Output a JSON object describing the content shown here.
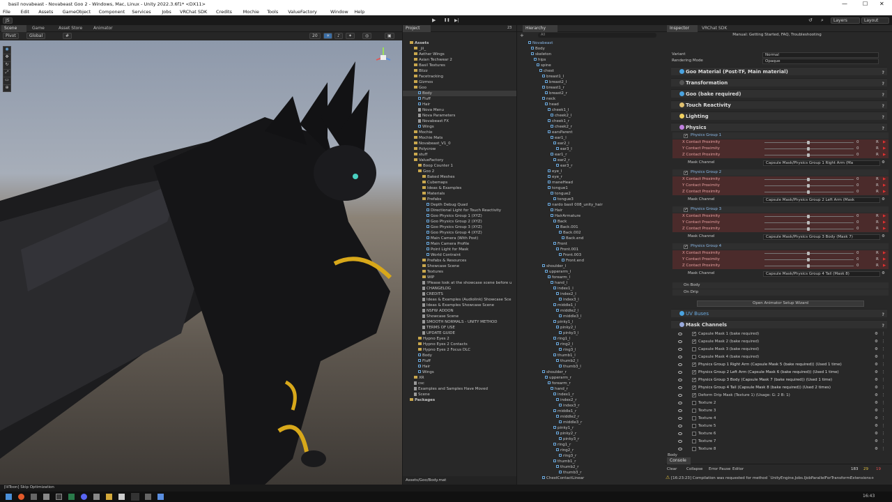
{
  "window": {
    "title": "basil novabeast - Novabeast Goo 2 - Windows, Mac, Linux - Unity 2022.3.6f1* <DX11>",
    "minimize": "—",
    "maximize": "☐",
    "close": "✕"
  },
  "menu": [
    "File",
    "Edit",
    "Assets",
    "GameObject",
    "Component",
    "Services",
    "Jobs",
    "VRChat SDK",
    "Credits",
    "Mochie",
    "Tools",
    "ValueFactory",
    "Window",
    "Help"
  ],
  "toolbar": {
    "account": "JS",
    "play": "▶",
    "pause": "❚❚",
    "step": "▶|",
    "layers": "Layers",
    "layout": "Layout"
  },
  "scene_tabs": [
    "Scene",
    "Game",
    "Asset Store",
    "Animator"
  ],
  "scene_toolbar": {
    "pivot": "Pivot",
    "global": "Global",
    "grid_size": "20"
  },
  "project": {
    "tab": "Project",
    "count": "23",
    "items": [
      {
        "label": "Assets",
        "d": 0,
        "k": "folder",
        "b": true
      },
      {
        "label": "_jii_",
        "d": 1,
        "k": "folder"
      },
      {
        "label": "Aether Wings",
        "d": 1,
        "k": "folder"
      },
      {
        "label": "Asian Techwear 2",
        "d": 1,
        "k": "folder"
      },
      {
        "label": "Basil Textures",
        "d": 1,
        "k": "folder"
      },
      {
        "label": "Blizz",
        "d": 1,
        "k": "folder"
      },
      {
        "label": "Facetracking",
        "d": 1,
        "k": "folder"
      },
      {
        "label": "Gizmos",
        "d": 1,
        "k": "folder"
      },
      {
        "label": "Goo",
        "d": 1,
        "k": "folder"
      },
      {
        "label": "Body",
        "d": 2,
        "k": "obj",
        "sel": true
      },
      {
        "label": "Fluff",
        "d": 2,
        "k": "obj"
      },
      {
        "label": "Hair",
        "d": 2,
        "k": "obj"
      },
      {
        "label": "Nova Menu",
        "d": 2,
        "k": "file"
      },
      {
        "label": "Nova Parameters",
        "d": 2,
        "k": "file"
      },
      {
        "label": "Novabeast FX",
        "d": 2,
        "k": "file"
      },
      {
        "label": "Wings",
        "d": 2,
        "k": "obj"
      },
      {
        "label": "Mochie",
        "d": 1,
        "k": "folder"
      },
      {
        "label": "Mochie Mats",
        "d": 1,
        "k": "folder"
      },
      {
        "label": "Novabeast_V1_0",
        "d": 1,
        "k": "folder"
      },
      {
        "label": "Polycrow",
        "d": 1,
        "k": "folder"
      },
      {
        "label": "stuff",
        "d": 1,
        "k": "folder"
      },
      {
        "label": "ValueFactory",
        "d": 1,
        "k": "folder"
      },
      {
        "label": "Boop Counter 1",
        "d": 2,
        "k": "folder"
      },
      {
        "label": "Goo 2",
        "d": 2,
        "k": "folder"
      },
      {
        "label": "Baked Meshes",
        "d": 3,
        "k": "folder"
      },
      {
        "label": "Cubemaps",
        "d": 3,
        "k": "folder"
      },
      {
        "label": "Ideas & Examples",
        "d": 3,
        "k": "folder"
      },
      {
        "label": "Materials",
        "d": 3,
        "k": "folder"
      },
      {
        "label": "Prefabs",
        "d": 3,
        "k": "folder"
      },
      {
        "label": "Depth Debug Quad",
        "d": 4,
        "k": "obj"
      },
      {
        "label": "Directional Light for Touch Reactivity",
        "d": 4,
        "k": "obj"
      },
      {
        "label": "Goo Physics Group 1 (XYZ)",
        "d": 4,
        "k": "obj"
      },
      {
        "label": "Goo Physics Group 2 (XYZ)",
        "d": 4,
        "k": "obj"
      },
      {
        "label": "Goo Physics Group 3 (XYZ)",
        "d": 4,
        "k": "obj"
      },
      {
        "label": "Goo Physics Group 4 (XYZ)",
        "d": 4,
        "k": "obj"
      },
      {
        "label": "Main Camera (With Post)",
        "d": 4,
        "k": "obj"
      },
      {
        "label": "Main Camera Profile",
        "d": 4,
        "k": "obj"
      },
      {
        "label": "Point Light for Mask",
        "d": 4,
        "k": "obj"
      },
      {
        "label": "World Contraint",
        "d": 4,
        "k": "obj"
      },
      {
        "label": "Prefabs & Resources",
        "d": 3,
        "k": "folder"
      },
      {
        "label": "Showcase Scene",
        "d": 3,
        "k": "folder"
      },
      {
        "label": "Textures",
        "d": 3,
        "k": "folder"
      },
      {
        "label": "WIP",
        "d": 3,
        "k": "folder"
      },
      {
        "label": "!Please look at the showcase scene before u",
        "d": 3,
        "k": "file"
      },
      {
        "label": "CHANGELOG",
        "d": 3,
        "k": "file"
      },
      {
        "label": "CREDITS",
        "d": 3,
        "k": "file"
      },
      {
        "label": "Ideas & Examples (Audiolink) Showcase Sce",
        "d": 3,
        "k": "file"
      },
      {
        "label": "Ideas & Examples Showcase Scene",
        "d": 3,
        "k": "file"
      },
      {
        "label": "NSFW ADDON",
        "d": 3,
        "k": "file"
      },
      {
        "label": "Showcase Scene",
        "d": 3,
        "k": "file"
      },
      {
        "label": "SMOOTH NORMALS - UNITY METHOD",
        "d": 3,
        "k": "file"
      },
      {
        "label": "TERMS OF USE",
        "d": 3,
        "k": "file"
      },
      {
        "label": "UPDATE GUIDE",
        "d": 3,
        "k": "file"
      },
      {
        "label": "Hypno Eyes 2",
        "d": 2,
        "k": "folder"
      },
      {
        "label": "Hypno Eyes 2 Contacts",
        "d": 2,
        "k": "folder"
      },
      {
        "label": "Hypno Eyes 2 Focus DLC",
        "d": 2,
        "k": "folder"
      },
      {
        "label": "Body",
        "d": 2,
        "k": "obj"
      },
      {
        "label": "Fluff",
        "d": 2,
        "k": "obj"
      },
      {
        "label": "Hair",
        "d": 2,
        "k": "obj"
      },
      {
        "label": "Wings",
        "d": 2,
        "k": "obj"
      },
      {
        "label": "XR",
        "d": 1,
        "k": "folder"
      },
      {
        "label": "csc",
        "d": 1,
        "k": "file"
      },
      {
        "label": "Examples and Samples Have Moved",
        "d": 1,
        "k": "file"
      },
      {
        "label": "Scene",
        "d": 1,
        "k": "file"
      },
      {
        "label": "Packages",
        "d": 0,
        "k": "folder",
        "b": true
      }
    ],
    "path": "Assets/Goo/Body.mat"
  },
  "hierarchy": {
    "tab": "Hierarchy",
    "search_placeholder": "All",
    "items": [
      {
        "label": "Novabeast",
        "d": 0
      },
      {
        "label": "Body",
        "d": 1
      },
      {
        "label": "skeleton",
        "d": 1
      },
      {
        "label": "hips",
        "d": 2
      },
      {
        "label": "spine",
        "d": 3
      },
      {
        "label": "chest",
        "d": 4
      },
      {
        "label": "breast1_l",
        "d": 5
      },
      {
        "label": "breast2_l",
        "d": 6
      },
      {
        "label": "breast1_r",
        "d": 5
      },
      {
        "label": "breast2_r",
        "d": 6
      },
      {
        "label": "neck",
        "d": 5
      },
      {
        "label": "head",
        "d": 6
      },
      {
        "label": "cheek1_l",
        "d": 7
      },
      {
        "label": "cheek2_l",
        "d": 8
      },
      {
        "label": "cheek1_r",
        "d": 7
      },
      {
        "label": "cheek2_r",
        "d": 8
      },
      {
        "label": "earsParent",
        "d": 7
      },
      {
        "label": "ear1_l",
        "d": 8
      },
      {
        "label": "ear2_l",
        "d": 9
      },
      {
        "label": "ear3_l",
        "d": 10
      },
      {
        "label": "ear1_r",
        "d": 8
      },
      {
        "label": "ear2_r",
        "d": 9
      },
      {
        "label": "ear3_r",
        "d": 10
      },
      {
        "label": "eye_l",
        "d": 7
      },
      {
        "label": "eye_r",
        "d": 7
      },
      {
        "label": "maneHead",
        "d": 7
      },
      {
        "label": "tongue1",
        "d": 7
      },
      {
        "label": "tongue2",
        "d": 8
      },
      {
        "label": "tongue3",
        "d": 9
      },
      {
        "label": "nardo basil 008_unity_hair",
        "d": 7
      },
      {
        "label": "Hair",
        "d": 8
      },
      {
        "label": "HairArmature",
        "d": 8
      },
      {
        "label": "Back",
        "d": 9
      },
      {
        "label": "Back.001",
        "d": 10
      },
      {
        "label": "Back.002",
        "d": 11
      },
      {
        "label": "Back.end",
        "d": 12
      },
      {
        "label": "Front",
        "d": 9
      },
      {
        "label": "Front.001",
        "d": 10
      },
      {
        "label": "Front.003",
        "d": 11
      },
      {
        "label": "Front.end",
        "d": 12
      },
      {
        "label": "shoulder_l",
        "d": 5
      },
      {
        "label": "upperarm_l",
        "d": 6
      },
      {
        "label": "forearm_l",
        "d": 7
      },
      {
        "label": "hand_l",
        "d": 8
      },
      {
        "label": "index1_l",
        "d": 9
      },
      {
        "label": "index2_l",
        "d": 10
      },
      {
        "label": "index3_l",
        "d": 11
      },
      {
        "label": "middle1_l",
        "d": 9
      },
      {
        "label": "middle2_l",
        "d": 10
      },
      {
        "label": "middle3_l",
        "d": 11
      },
      {
        "label": "pinky1_l",
        "d": 9
      },
      {
        "label": "pinky2_l",
        "d": 10
      },
      {
        "label": "pinky3_l",
        "d": 11
      },
      {
        "label": "ring1_l",
        "d": 9
      },
      {
        "label": "ring2_l",
        "d": 10
      },
      {
        "label": "ring3_l",
        "d": 11
      },
      {
        "label": "thumb1_l",
        "d": 9
      },
      {
        "label": "thumb2_l",
        "d": 10
      },
      {
        "label": "thumb3_l",
        "d": 11
      },
      {
        "label": "shoulder_r",
        "d": 5
      },
      {
        "label": "upperarm_r",
        "d": 6
      },
      {
        "label": "forearm_r",
        "d": 7
      },
      {
        "label": "hand_r",
        "d": 8
      },
      {
        "label": "index1_r",
        "d": 9
      },
      {
        "label": "index2_r",
        "d": 10
      },
      {
        "label": "index3_r",
        "d": 11
      },
      {
        "label": "middle1_r",
        "d": 9
      },
      {
        "label": "middle2_r",
        "d": 10
      },
      {
        "label": "middle3_r",
        "d": 11
      },
      {
        "label": "pinky1_r",
        "d": 9
      },
      {
        "label": "pinky2_r",
        "d": 10
      },
      {
        "label": "pinky3_r",
        "d": 11
      },
      {
        "label": "ring1_r",
        "d": 9
      },
      {
        "label": "ring2_r",
        "d": 10
      },
      {
        "label": "ring3_r",
        "d": 11
      },
      {
        "label": "thumb1_r",
        "d": 9
      },
      {
        "label": "thumb2_r",
        "d": 10
      },
      {
        "label": "thumb3_r",
        "d": 11
      },
      {
        "label": "ChestContactLinear",
        "d": 5
      }
    ]
  },
  "inspector": {
    "tabs": [
      "Inspector",
      "VRChat SDK"
    ],
    "banner": "Manual: Getting Started, FAQ, Troubleshooting",
    "variant_label": "Variant",
    "variant_value": "Normal",
    "rendering_label": "Rendering Mode",
    "rendering_value": "Opaque",
    "sections": [
      {
        "label": "Goo Material (Post-TF, Main material)",
        "color": "#4aa3e0"
      },
      {
        "label": "Transformation",
        "color": "#555555"
      },
      {
        "label": "Goo (bake required)",
        "color": "#4aa3e0"
      },
      {
        "label": "Touch Reactivity",
        "color": "#e0c070"
      },
      {
        "label": "Lighting",
        "color": "#f0d060"
      },
      {
        "label": "Physics",
        "color": "#c080e0"
      }
    ],
    "groups": [
      {
        "name": "Physics Group 1",
        "mask": "Capsule Mask/Physics Group 1 Right Arm (Ma"
      },
      {
        "name": "Physics Group 2",
        "mask": "Capsule Mask/Physics Group 2 Left Arm (Mask"
      },
      {
        "name": "Physics Group 3",
        "mask": "Capsule Mask/Physics Group 3 Body (Mask 7)"
      },
      {
        "name": "Physics Group 4",
        "mask": "Capsule Mask/Physics Group 4 Tail (Mask 8)"
      }
    ],
    "axes": [
      "X Contact Proximity",
      "Y Contact Proximity",
      "Z Contact Proximity"
    ],
    "axis_value": "0",
    "mask_channel_label": "Mask Channel",
    "on_body": "On Body",
    "on_drip": "On Drip",
    "wizard_button": "Open Animator Setup Wizard",
    "uv_buses": "UV Buses",
    "mask_channels": "Mask Channels",
    "masks": [
      {
        "label": "Capsule Mask 1 (bake required)",
        "on": true
      },
      {
        "label": "Capsule Mask 2 (bake required)",
        "on": true
      },
      {
        "label": "Capsule Mask 3 (bake required)",
        "on": false
      },
      {
        "label": "Capsule Mask 4 (bake required)",
        "on": false
      },
      {
        "label": "Physics Group 1 Right Arm (Capsule Mask 5 (bake required)) (Used 1 time)",
        "on": true
      },
      {
        "label": "Physics Group 2 Left Arm (Capsule Mask 6 (bake required)) (Used 1 time)",
        "on": true
      },
      {
        "label": "Physics Group 3 Body (Capsule Mask 7 (bake required)) (Used 1 time)",
        "on": true
      },
      {
        "label": "Physics Group 4 Tail (Capsule Mask 8 (bake required)) (Used 2 times)",
        "on": true
      },
      {
        "label": "Deform Drip Mask (Texture 1) (Usage: G: 2 B: 1)",
        "on": true
      },
      {
        "label": "Texture 2",
        "on": false
      },
      {
        "label": "Texture 3",
        "on": false
      },
      {
        "label": "Texture 4",
        "on": false
      },
      {
        "label": "Texture 5",
        "on": false
      },
      {
        "label": "Texture 6",
        "on": false
      },
      {
        "label": "Texture 7",
        "on": false
      },
      {
        "label": "Texture 8",
        "on": false
      }
    ],
    "footer": "Body"
  },
  "console": {
    "tab": "Console",
    "buttons": [
      "Clear",
      "Collapse",
      "Error Pause",
      "Editor"
    ],
    "counts": [
      "183",
      "29",
      "19"
    ],
    "message": "[16:23:23] Compilation was requested for method `UnityEngine.Jobs.IJobParallelForTransformExtensions+"
  },
  "status": {
    "left": "[lilToon] Skip Optimization",
    "time": "16:43"
  }
}
